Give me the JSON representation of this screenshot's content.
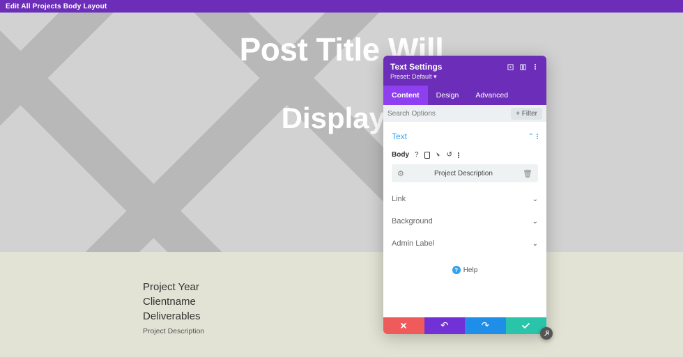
{
  "topbar": {
    "title": "Edit All Projects Body Layout"
  },
  "hero": {
    "line1": "Post Title Will",
    "line2": "Display I"
  },
  "meta": {
    "year": "Project Year",
    "client": "Clientname",
    "deliverables": "Deliverables",
    "desc": "Project Description"
  },
  "panel": {
    "title": "Text Settings",
    "preset": "Preset: Default ▾",
    "tabs": {
      "content": "Content",
      "design": "Design",
      "advanced": "Advanced"
    },
    "search_placeholder": "Search Options",
    "filter_label": "+ Filter",
    "section_text": "Text",
    "body_label": "Body",
    "dynamic_value": "Project Description",
    "sections": {
      "link": "Link",
      "background": "Background",
      "admin": "Admin Label"
    },
    "help_label": "Help"
  }
}
